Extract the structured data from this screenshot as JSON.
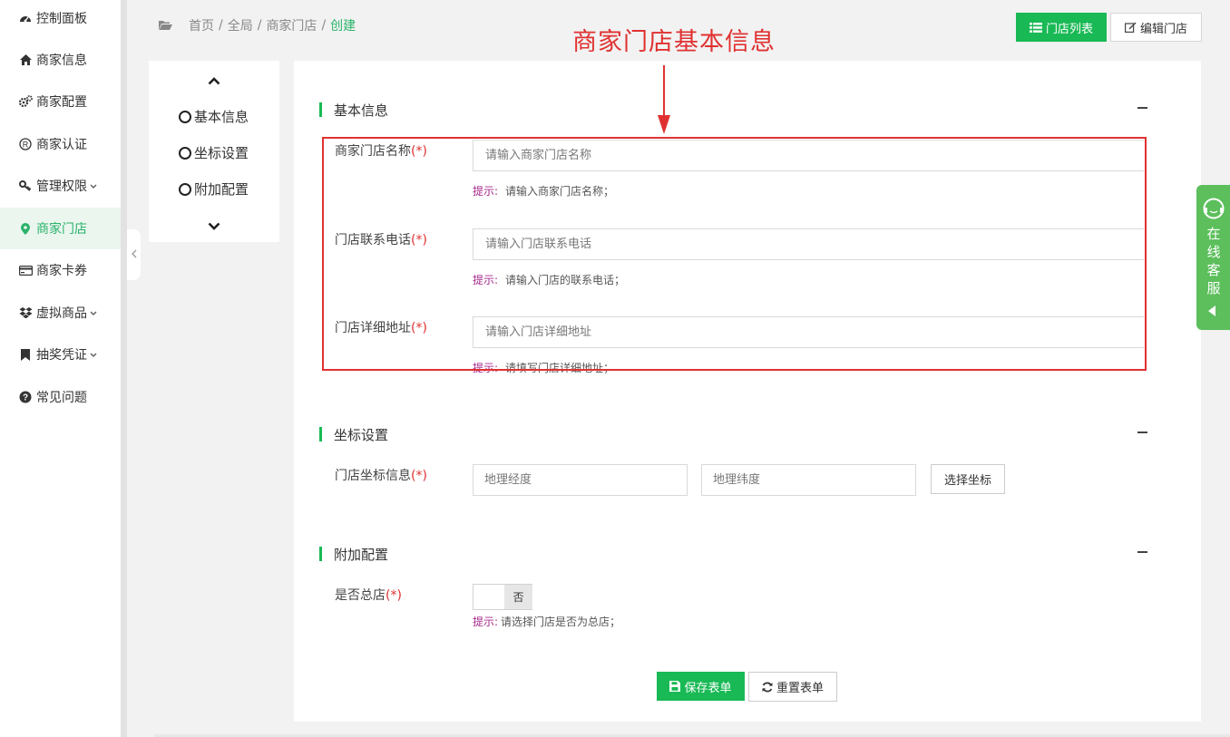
{
  "sidebar": {
    "items": [
      {
        "label": "控制面板",
        "icon": "dashboard-icon",
        "has_children": false,
        "active": false
      },
      {
        "label": "商家信息",
        "icon": "home-icon",
        "has_children": false,
        "active": false
      },
      {
        "label": "商家配置",
        "icon": "cogs-icon",
        "has_children": false,
        "active": false
      },
      {
        "label": "商家认证",
        "icon": "registered-icon",
        "has_children": false,
        "active": false
      },
      {
        "label": "管理权限",
        "icon": "key-icon",
        "has_children": true,
        "active": false
      },
      {
        "label": "商家门店",
        "icon": "map-marker-icon",
        "has_children": false,
        "active": true
      },
      {
        "label": "商家卡券",
        "icon": "credit-card-icon",
        "has_children": false,
        "active": false
      },
      {
        "label": "虚拟商品",
        "icon": "dropbox-icon",
        "has_children": true,
        "active": false
      },
      {
        "label": "抽奖凭证",
        "icon": "bookmark-icon",
        "has_children": true,
        "active": false
      },
      {
        "label": "常见问题",
        "icon": "question-circle-icon",
        "has_children": false,
        "active": false
      }
    ]
  },
  "breadcrumb": {
    "items": [
      "首页",
      "全局",
      "商家门店"
    ],
    "separator": "/",
    "current": "创建"
  },
  "toolbar": {
    "list_label": "门店列表",
    "edit_label": "编辑门店"
  },
  "annotation": {
    "title": "商家门店基本信息",
    "color": "#e03131"
  },
  "subnav": {
    "items": [
      "基本信息",
      "坐标设置",
      "附加配置"
    ]
  },
  "form": {
    "required_mark": "(*)",
    "hint_label": "提示:",
    "sections": {
      "basic": {
        "title": "基本信息",
        "name": {
          "label": "商家门店名称",
          "placeholder": "请输入商家门店名称",
          "value": "",
          "hint": "请输入商家门店名称；"
        },
        "phone": {
          "label": "门店联系电话",
          "placeholder": "请输入门店联系电话",
          "value": "",
          "hint": "请输入门店的联系电话；"
        },
        "address": {
          "label": "门店详细地址",
          "placeholder": "请输入门店详细地址",
          "value": "",
          "hint": "请填写门店详细地址；"
        }
      },
      "coords": {
        "title": "坐标设置",
        "label": "门店坐标信息",
        "longitude_placeholder": "地理经度",
        "latitude_placeholder": "地理纬度",
        "pick_label": "选择坐标"
      },
      "extra": {
        "title": "附加配置",
        "headquarters": {
          "label": "是否总店",
          "switch_text": "否",
          "checked": false,
          "hint": "请选择门店是否为总店；"
        }
      }
    },
    "save_label": "保存表单",
    "reset_label": "重置表单"
  },
  "customer_service": {
    "label": "在线客服",
    "chars": [
      "在",
      "线",
      "客",
      "服"
    ]
  },
  "colors": {
    "accent": "#19b955",
    "active_text": "#2ab36a",
    "active_bg": "#ebf6ef",
    "hint_label": "#a52a8c",
    "required": "#e03131",
    "cs_tab": "#5cbf5c"
  }
}
